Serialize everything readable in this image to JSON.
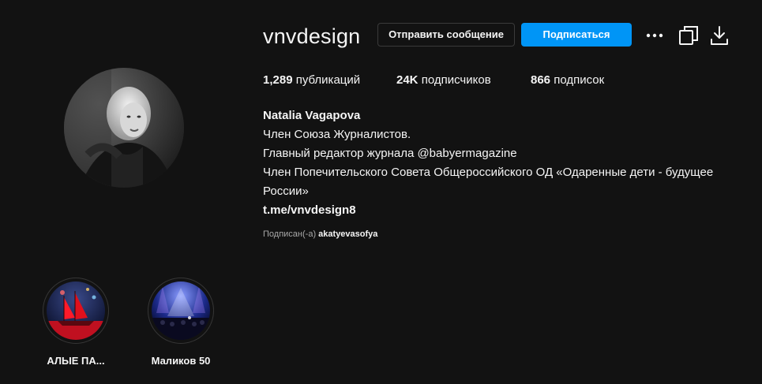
{
  "profile": {
    "username": "vnvdesign",
    "avatar_icon": "profile-photo-avatar"
  },
  "actions": {
    "message_label": "Отправить сообщение",
    "follow_label": "Подписаться",
    "more_icon": "more-options-icon",
    "copy_icon": "copy-icon",
    "download_icon": "download-icon"
  },
  "stats": {
    "posts_count": "1,289",
    "posts_label": "публикаций",
    "followers_count": "24K",
    "followers_label": "подписчиков",
    "following_count": "866",
    "following_label": "подписок"
  },
  "bio": {
    "name": "Natalia Vagapova",
    "lines": [
      "Член Союза Журналистов.",
      "Главный редактор журнала @babyermagazine",
      "Член Попечительского Совета Общероссийского ОД «Одаренные дети - будущее России»"
    ],
    "link": "t.me/vnvdesign8"
  },
  "followed_by": {
    "prefix": "Подписан(-а)",
    "user": "akatyevasofya"
  },
  "highlights": [
    {
      "label": "АЛЫЕ ПА...",
      "image": "red-sails-ship-image"
    },
    {
      "label": "Маликов 50",
      "image": "concert-stage-image"
    }
  ],
  "colors": {
    "background": "#121212",
    "accent": "#0095f6",
    "text": "#f5f5f5",
    "muted": "#a8a8a8"
  }
}
